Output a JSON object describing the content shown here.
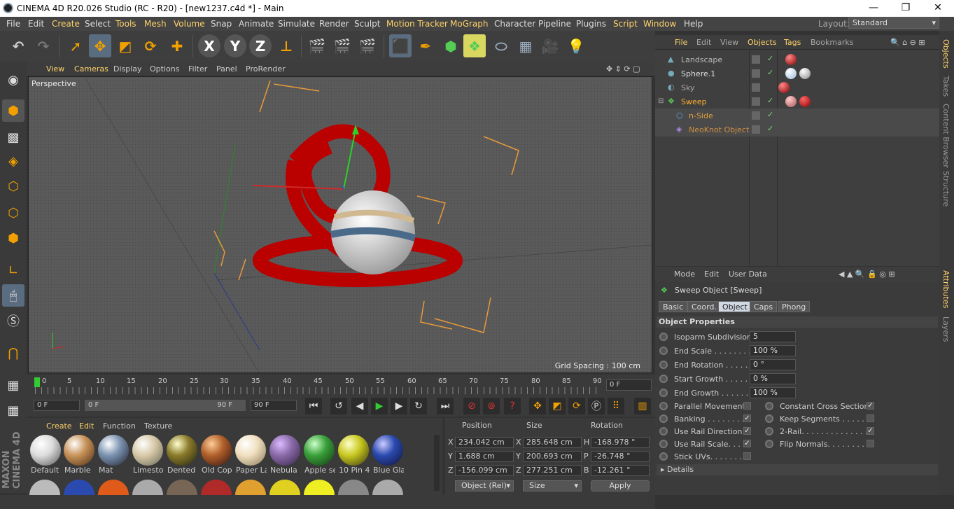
{
  "window": {
    "title": "CINEMA 4D R20.026 Studio (RC - R20) - [new1237.c4d *] - Main",
    "minimize": "—",
    "maximize": "❐",
    "close": "✕"
  },
  "menu": [
    "File",
    "Edit",
    "Create",
    "Select",
    "Tools",
    "Mesh",
    "Volume",
    "Snap",
    "Animate",
    "Simulate",
    "Render",
    "Sculpt",
    "Motion Tracker",
    "MoGraph",
    "Character",
    "Pipeline",
    "Plugins",
    "Script",
    "Window",
    "Help"
  ],
  "layout": {
    "label": "Layout:",
    "value": "Standard"
  },
  "viewport": {
    "menu": [
      "View",
      "Cameras",
      "Display",
      "Options",
      "Filter",
      "Panel",
      "ProRender"
    ],
    "camera": "Perspective",
    "grid_spacing": "Grid Spacing : 100 cm"
  },
  "timeline": {
    "ticks": [
      "0",
      "5",
      "10",
      "15",
      "20",
      "25",
      "30",
      "35",
      "40",
      "45",
      "50",
      "55",
      "60",
      "65",
      "70",
      "75",
      "80",
      "85",
      "90"
    ],
    "current": "0 F"
  },
  "transport": {
    "start": "0 F",
    "range_start": "0 F",
    "range_end": "90 F",
    "end": "90 F"
  },
  "materials": {
    "menu": [
      "Create",
      "Edit",
      "Function",
      "Texture"
    ],
    "items": [
      {
        "name": "Default",
        "color": "#dcdcdc"
      },
      {
        "name": "Marble",
        "color": "#c8935a"
      },
      {
        "name": "Mat",
        "color": "#7b93b0"
      },
      {
        "name": "Limestor",
        "color": "#d8c9a8"
      },
      {
        "name": "Dented",
        "color": "#8a7a2a"
      },
      {
        "name": "Old Cop",
        "color": "#b0602a"
      },
      {
        "name": "Paper La",
        "color": "#f0e0c0"
      },
      {
        "name": "Nebula",
        "color": "#8a6aa8"
      },
      {
        "name": "Apple se",
        "color": "#3aa03a"
      },
      {
        "name": "10 Pin 4",
        "color": "#c8c820"
      },
      {
        "name": "Blue Gla",
        "color": "#2a4ab0"
      }
    ]
  },
  "coords": {
    "headers": [
      "Position",
      "Size",
      "Rotation"
    ],
    "rows": [
      {
        "axis": "X",
        "pos": "234.042 cm",
        "saxis": "X",
        "size": "285.648 cm",
        "raxis": "H",
        "rot": "-168.978 °"
      },
      {
        "axis": "Y",
        "pos": "1.688 cm",
        "saxis": "Y",
        "size": "200.693 cm",
        "raxis": "P",
        "rot": "-26.748 °"
      },
      {
        "axis": "Z",
        "pos": "-156.099 cm",
        "saxis": "Z",
        "size": "277.251 cm",
        "raxis": "B",
        "rot": "-12.261 °"
      }
    ],
    "mode": "Object (Rel)",
    "size_mode": "Size",
    "apply": "Apply"
  },
  "object_manager": {
    "menu": [
      "File",
      "Edit",
      "View",
      "Objects",
      "Tags",
      "Bookmarks"
    ],
    "objects": [
      {
        "name": "Landscape",
        "color": "#bbbbbb"
      },
      {
        "name": "Sphere.1",
        "color": "#dddddd"
      },
      {
        "name": "Sky",
        "color": "#aaaaaa"
      },
      {
        "name": "Sweep",
        "color": "#ffb030"
      },
      {
        "name": "n-Side",
        "color": "#e0a040"
      },
      {
        "name": "NeoKnot Object",
        "color": "#d09040"
      }
    ]
  },
  "side_tabs": [
    "Objects",
    "Takes",
    "Content Browser",
    "Structure",
    "Attributes",
    "Layers"
  ],
  "attributes": {
    "menu": [
      "Mode",
      "Edit",
      "User Data"
    ],
    "title": "Sweep Object [Sweep]",
    "tabs": [
      "Basic",
      "Coord.",
      "Object",
      "Caps",
      "Phong"
    ],
    "section": "Object Properties",
    "fields": [
      {
        "label": "Isoparm Subdivision",
        "value": "5"
      },
      {
        "label": "End Scale . . . . . . . . .",
        "value": "100 %"
      },
      {
        "label": "End Rotation . . . . . .",
        "value": "0 °"
      },
      {
        "label": "Start Growth . . . . . .",
        "value": "0 %"
      },
      {
        "label": "End Growth . . . . . . .",
        "value": "100 %"
      }
    ],
    "checks_left": [
      {
        "label": "Parallel Movement",
        "checked": ""
      },
      {
        "label": "Banking . . . . . . . .",
        "checked": "✓"
      },
      {
        "label": "Use Rail Direction",
        "checked": "✓"
      },
      {
        "label": "Use Rail Scale. . . .",
        "checked": "✓"
      },
      {
        "label": "Stick UVs. . . . . . . .",
        "checked": ""
      }
    ],
    "checks_right": [
      {
        "label": "Constant Cross Section",
        "checked": "✓"
      },
      {
        "label": "Keep Segments . . . . . .",
        "checked": ""
      },
      {
        "label": "2-Rail. . . . . . . . . . . . . .",
        "checked": "✓"
      },
      {
        "label": "Flip Normals. . . . . . . . .",
        "checked": ""
      }
    ],
    "details": "Details"
  },
  "brand": "MAXON CINEMA 4D"
}
